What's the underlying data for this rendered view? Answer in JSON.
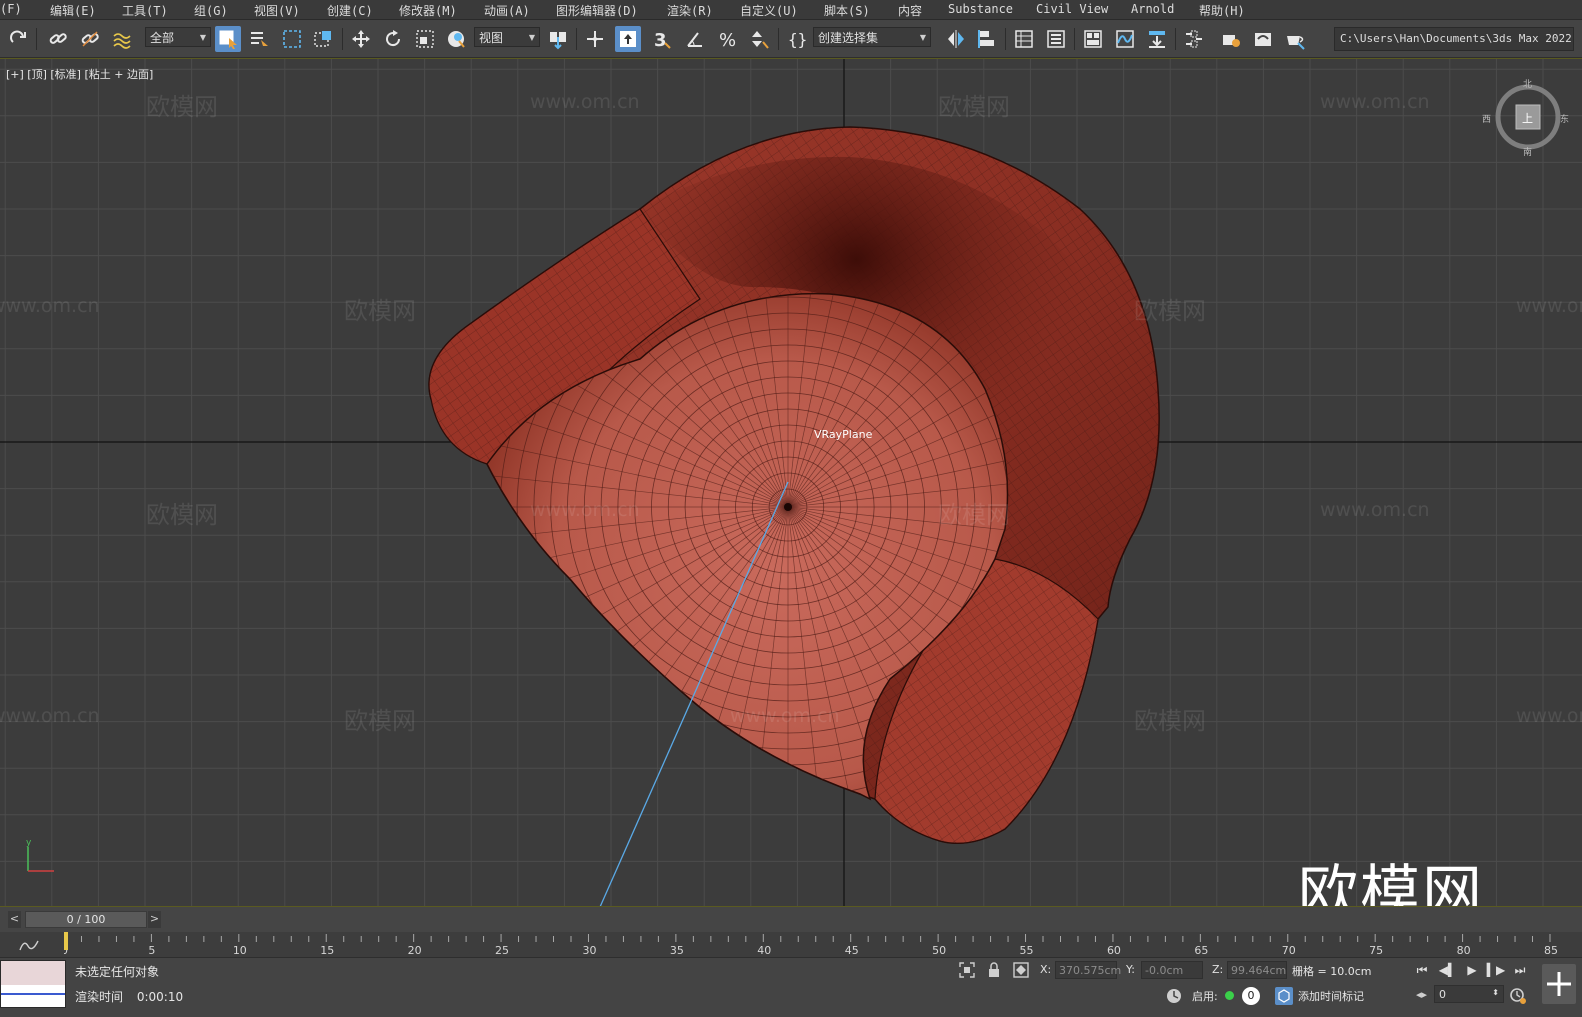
{
  "menu": {
    "items": [
      "(F)",
      "编辑(E)",
      "工具(T)",
      "组(G)",
      "视图(V)",
      "创建(C)",
      "修改器(M)",
      "动画(A)",
      "图形编辑器(D)",
      "渲染(R)",
      "自定义(U)",
      "脚本(S)",
      "内容",
      "Substance",
      "Civil View",
      "Arnold",
      "帮助(H)"
    ]
  },
  "toolbar": {
    "filter_value": "全部",
    "coord_value": "视图",
    "selection_set_placeholder": "创建选择集",
    "project_path": "C:\\Users\\Han\\Documents\\3ds Max 2022",
    "snap_label": "3"
  },
  "viewport": {
    "label": "[+] [顶] [标准] [粘土 + 边面]",
    "object_label": "VRayPlane",
    "watermark_text": "欧模网",
    "watermark_url": "www.om.cn",
    "big_watermark": "欧模网",
    "viewcube_labels": {
      "north": "北",
      "south": "南",
      "east": "东",
      "west": "西",
      "face": "上"
    },
    "colors": {
      "background": "#3c3c3c",
      "grid": "#4a4a4a",
      "model": "#9b3a2c",
      "wire": "#3a1410",
      "light_line": "#5aa9e6"
    }
  },
  "timeslider": {
    "value": "0 / 100",
    "prev": "<",
    "next": ">"
  },
  "trackbar": {
    "ticks": [
      "0",
      "5",
      "10",
      "15",
      "20",
      "25",
      "30",
      "35",
      "40",
      "45",
      "50",
      "55",
      "60",
      "65",
      "70",
      "75",
      "80",
      "85"
    ]
  },
  "status": {
    "message": "未选定任何对象",
    "render_time_label": "渲染时间",
    "render_time_value": "0:00:10",
    "x_label": "X:",
    "x_value": "370.575cm",
    "y_label": "Y:",
    "y_value": "-0.0cm",
    "z_label": "Z:",
    "z_value": "99.464cm",
    "grid_text": "栅格 = 10.0cm",
    "enable_label": "启用:",
    "enable_count": "0",
    "add_time_tag": "添加时间标记",
    "frame_value": "0"
  }
}
